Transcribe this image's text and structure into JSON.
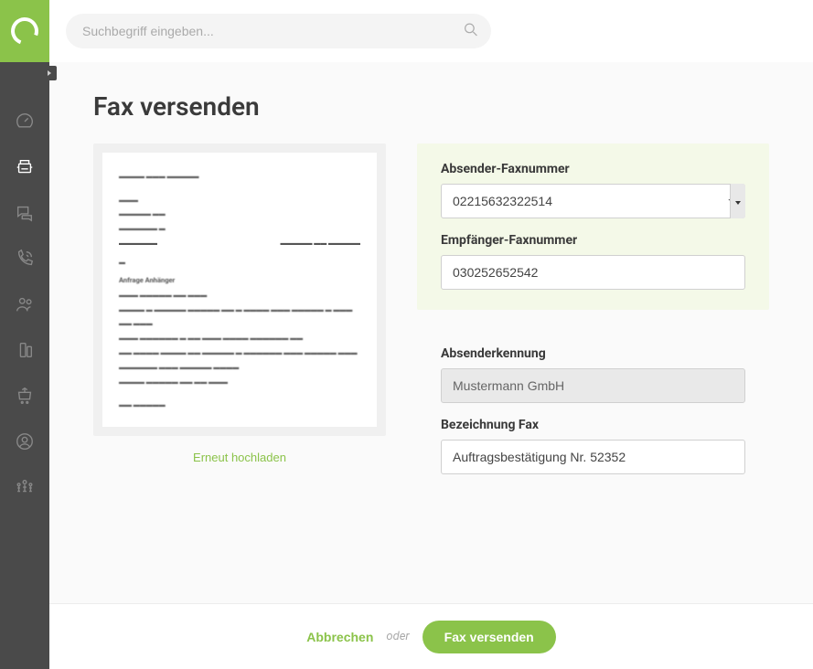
{
  "search": {
    "placeholder": "Suchbegriff eingeben..."
  },
  "page": {
    "title": "Fax versenden"
  },
  "preview": {
    "reupload_label": "Erneut hochladen"
  },
  "form": {
    "sender_fax_label": "Absender-Faxnummer",
    "sender_fax_value": "02215632322514",
    "recipient_fax_label": "Empfänger-Faxnummer",
    "recipient_fax_value": "030252652542",
    "sender_id_label": "Absenderkennung",
    "sender_id_value": "Mustermann GmbH",
    "fax_name_label": "Bezeichnung Fax",
    "fax_name_value": "Auftragsbestätigung Nr. 52352"
  },
  "footer": {
    "cancel_label": "Abbrechen",
    "or_label": "oder",
    "send_label": "Fax versenden"
  }
}
